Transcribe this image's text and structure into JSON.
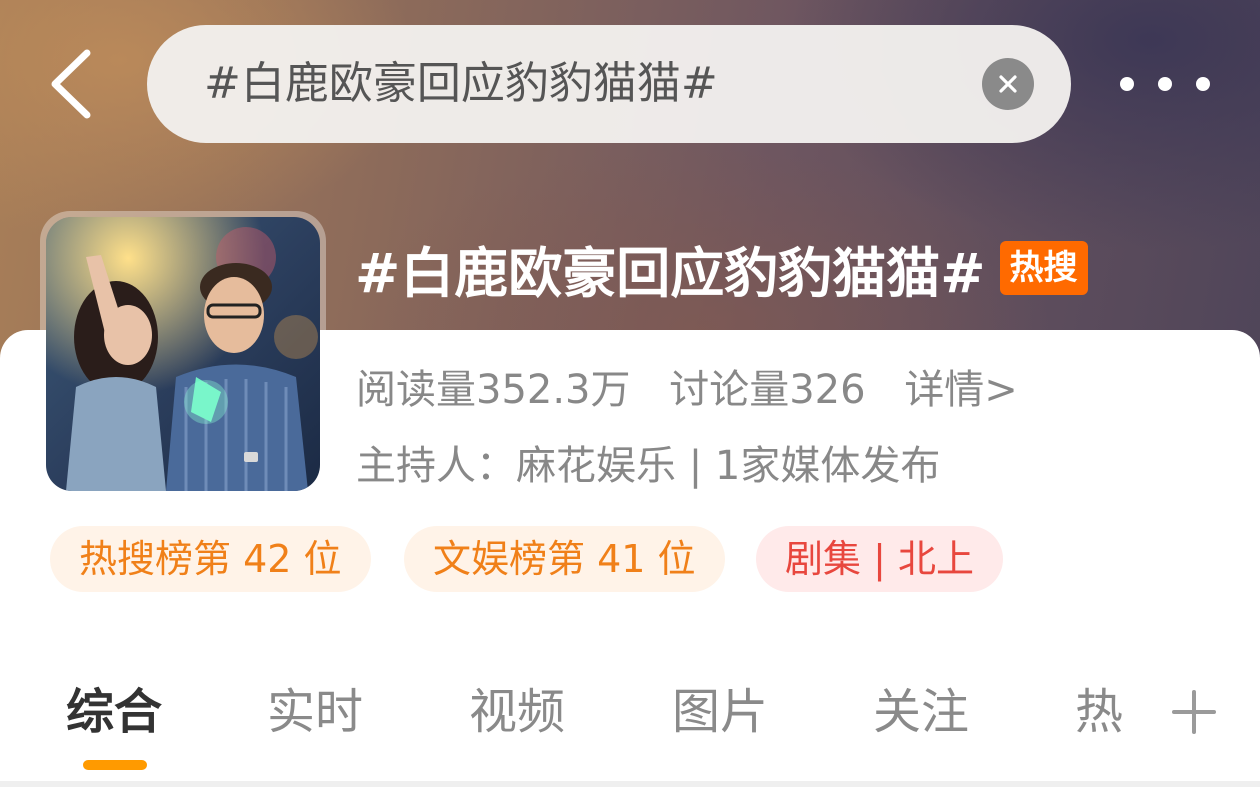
{
  "header": {
    "search_text": "#白鹿欧豪回应豹豹猫猫#",
    "back_icon": "chevron-left-icon",
    "clear_icon": "close-circle-icon",
    "more_icon": "more-horizontal-icon"
  },
  "topic": {
    "title": "#白鹿欧豪回应豹豹猫猫#",
    "badge": "热搜",
    "reads": "阅读量352.3万",
    "discussions": "讨论量326",
    "details_link": "详情>",
    "host": "主持人：麻花娱乐 | 1家媒体发布"
  },
  "chips": [
    {
      "label": "热搜榜第 42 位"
    },
    {
      "label": "文娱榜第 41 位"
    },
    {
      "label": "剧集 | 北上"
    }
  ],
  "tabs": [
    {
      "label": "综合",
      "active": true
    },
    {
      "label": "实时"
    },
    {
      "label": "视频"
    },
    {
      "label": "图片"
    },
    {
      "label": "关注"
    },
    {
      "label": "热"
    }
  ],
  "tab_add_icon": "plus-icon",
  "colors": {
    "accent_orange": "#ff9a00",
    "badge_orange": "#ff6a00",
    "chip_orange_text": "#f08019",
    "chip_red_text": "#e8473e"
  }
}
